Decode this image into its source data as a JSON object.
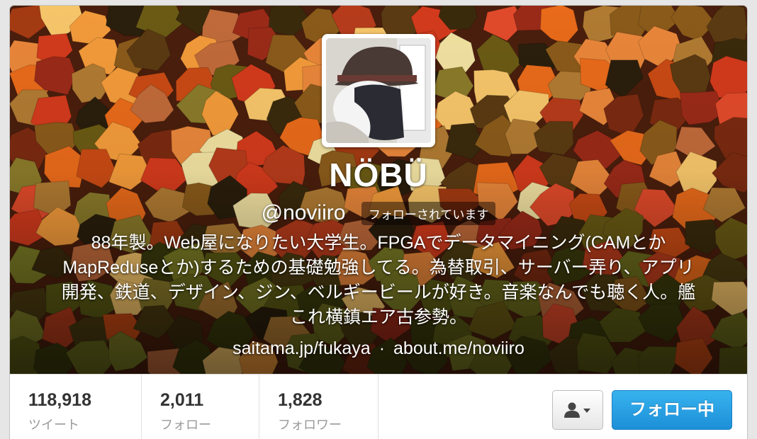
{
  "profile": {
    "display_name": "NÖBÜ",
    "handle": "@noviiro",
    "follows_you_badge": "フォローされています",
    "bio": "88年製。Web屋になりたい大学生。FPGAでデータマイニング(CAMとかMapReduseとか)するための基礎勉強してる。為替取引、サーバー弄り、アプリ開発、鉄道、デザイン、ジン、ベルギービールが好き。音楽なんでも聴く人。艦これ横鎮エア古参勢。",
    "location": "saitama.jp/fukaya",
    "separator": "·",
    "website": "about.me/noviiro"
  },
  "stats": [
    {
      "value": "118,918",
      "label": "ツイート"
    },
    {
      "value": "2,011",
      "label": "フォロー"
    },
    {
      "value": "1,828",
      "label": "フォロワー"
    }
  ],
  "actions": {
    "user_menu_icon": "person-icon",
    "follow_button_label": "フォロー中"
  },
  "colors": {
    "follow_button": "#2a9fe3",
    "header_bg": "#6b2a10"
  }
}
